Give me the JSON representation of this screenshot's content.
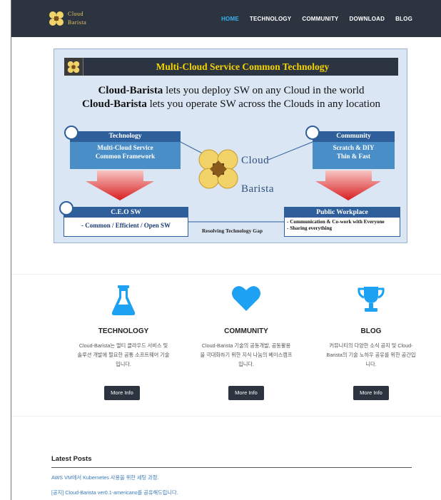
{
  "brand": {
    "name_line1": "Cloud",
    "name_line2": "Barista"
  },
  "nav": {
    "items": [
      {
        "label": "HOME",
        "active": true
      },
      {
        "label": "TECHNOLOGY",
        "active": false
      },
      {
        "label": "COMMUNITY",
        "active": false
      },
      {
        "label": "DOWNLOAD",
        "active": false
      },
      {
        "label": "BLOG",
        "active": false
      }
    ]
  },
  "hero": {
    "title": "Multi-Cloud Service Common Technology",
    "line1_strong": "Cloud-Barista",
    "line1_rest": " lets you deploy SW on any Cloud in the world",
    "line2_strong": "Cloud-Barista",
    "line2_rest": " lets you operate SW across the Clouds in any location",
    "tech_head": "Technology",
    "tech_body1": "Multi-Cloud Service",
    "tech_body2": "Common Framework",
    "comm_head": "Community",
    "comm_body1": "Scratch & DIY",
    "comm_body2": "Thin & Fast",
    "ceo_head": "C.E.O SW",
    "ceo_body": "- Common / Efficient / Open SW",
    "pub_head": "Public Workplace",
    "pub_body1": "- Communication & Co-work with Everyone",
    "pub_body2": "- Sharing everything",
    "gap": "Resolving Technology Gap",
    "logo_word1": "Cloud",
    "logo_word2": "Barista"
  },
  "features": [
    {
      "icon": "flask-icon",
      "title": "TECHNOLOGY",
      "desc": "Cloud-Barista는 멀티 클라우드 서비스 및 솔루션 개발에 필요한 공통 소프트웨어 기술입니다.",
      "button": "More Info"
    },
    {
      "icon": "heart-icon",
      "title": "COMMUNITY",
      "desc": "Cloud-Barista 기술의 공동개발, 공동활용을 극대화하기 위한 지식 나눔의 베이스캠프입니다.",
      "button": "More Info"
    },
    {
      "icon": "trophy-icon",
      "title": "BLOG",
      "desc": "커뮤니티의 다양한 소식 공지 및 Cloud-Barista의 기술 노하우 공유를 위한 공간입니다.",
      "button": "More Info"
    }
  ],
  "posts": {
    "title": "Latest Posts",
    "items": [
      "AWS VM에서 Kubernetes 사용을 위한 세팅 과정.",
      "[공지] Cloud-Barista ver0.1-americano를 공유해드립니다."
    ]
  },
  "colors": {
    "navbar": "#2c3440",
    "active_link": "#34b3f0",
    "accent": "#1da1f2",
    "hero_bg": "#dbe6f4",
    "hero_title": "#f4d400"
  }
}
